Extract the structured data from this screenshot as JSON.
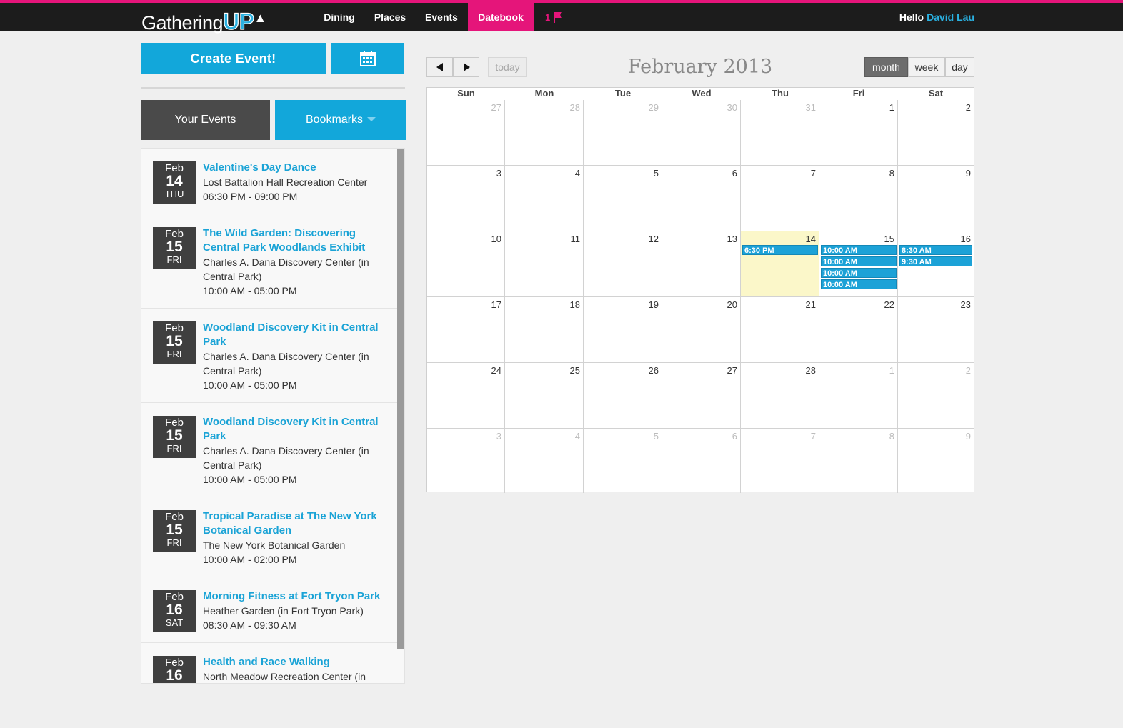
{
  "brand": {
    "name": "Gathering",
    "name_accent": "UP"
  },
  "nav": {
    "items": [
      {
        "label": "Dining"
      },
      {
        "label": "Places"
      },
      {
        "label": "Events"
      },
      {
        "label": "Datebook",
        "active": true
      }
    ],
    "flag_count": "1",
    "hello_label": "Hello",
    "user_name": "David Lau"
  },
  "sidebar": {
    "create_label": "Create Event!",
    "calendar_icon": "calendar-icon",
    "tab_your_events": "Your Events",
    "tab_bookmarks": "Bookmarks",
    "events": [
      {
        "month": "Feb",
        "day": "14",
        "weekday": "THU",
        "title": "Valentine's Day Dance",
        "place": "Lost Battalion Hall Recreation Center",
        "time": "06:30 PM - 09:00 PM"
      },
      {
        "month": "Feb",
        "day": "15",
        "weekday": "FRI",
        "title": "The Wild Garden: Discovering Central Park Woodlands Exhibit",
        "place": "Charles A. Dana Discovery Center (in Central Park)",
        "time": "10:00 AM - 05:00 PM"
      },
      {
        "month": "Feb",
        "day": "15",
        "weekday": "FRI",
        "title": "Woodland Discovery Kit in Central Park",
        "place": "Charles A. Dana Discovery Center (in Central Park)",
        "time": "10:00 AM - 05:00 PM"
      },
      {
        "month": "Feb",
        "day": "15",
        "weekday": "FRI",
        "title": "Woodland Discovery Kit in Central Park",
        "place": "Charles A. Dana Discovery Center (in Central Park)",
        "time": "10:00 AM - 05:00 PM"
      },
      {
        "month": "Feb",
        "day": "15",
        "weekday": "FRI",
        "title": "Tropical Paradise at The New York Botanical Garden",
        "place": "The New York Botanical Garden",
        "time": "10:00 AM - 02:00 PM"
      },
      {
        "month": "Feb",
        "day": "16",
        "weekday": "SAT",
        "title": "Morning Fitness at Fort Tryon Park",
        "place": "Heather Garden (in Fort Tryon Park)",
        "time": "08:30 AM - 09:30 AM"
      },
      {
        "month": "Feb",
        "day": "16",
        "weekday": "",
        "title": "Health and Race Walking",
        "place": "North Meadow Recreation Center (in",
        "time": ""
      }
    ]
  },
  "calendar": {
    "title": "February 2013",
    "prev_icon": "prev-arrow-icon",
    "next_icon": "next-arrow-icon",
    "today_label": "today",
    "views": [
      {
        "label": "month",
        "active": true
      },
      {
        "label": "week",
        "active": false
      },
      {
        "label": "day",
        "active": false
      }
    ],
    "weekdays": [
      "Sun",
      "Mon",
      "Tue",
      "Wed",
      "Thu",
      "Fri",
      "Sat"
    ],
    "weeks": [
      [
        {
          "n": "27",
          "other": true
        },
        {
          "n": "28",
          "other": true
        },
        {
          "n": "29",
          "other": true
        },
        {
          "n": "30",
          "other": true
        },
        {
          "n": "31",
          "other": true
        },
        {
          "n": "1"
        },
        {
          "n": "2"
        }
      ],
      [
        {
          "n": "3"
        },
        {
          "n": "4"
        },
        {
          "n": "5"
        },
        {
          "n": "6"
        },
        {
          "n": "7"
        },
        {
          "n": "8"
        },
        {
          "n": "9"
        }
      ],
      [
        {
          "n": "10"
        },
        {
          "n": "11"
        },
        {
          "n": "12"
        },
        {
          "n": "13"
        },
        {
          "n": "14",
          "today": true,
          "events": [
            "6:30 PM"
          ]
        },
        {
          "n": "15",
          "events": [
            "10:00 AM",
            "10:00 AM",
            "10:00 AM",
            "10:00 AM"
          ]
        },
        {
          "n": "16",
          "events": [
            "8:30 AM",
            "9:30 AM"
          ]
        }
      ],
      [
        {
          "n": "17"
        },
        {
          "n": "18"
        },
        {
          "n": "19"
        },
        {
          "n": "20"
        },
        {
          "n": "21"
        },
        {
          "n": "22"
        },
        {
          "n": "23"
        }
      ],
      [
        {
          "n": "24"
        },
        {
          "n": "25"
        },
        {
          "n": "26"
        },
        {
          "n": "27"
        },
        {
          "n": "28"
        },
        {
          "n": "1",
          "other": true
        },
        {
          "n": "2",
          "other": true
        }
      ],
      [
        {
          "n": "3",
          "other": true
        },
        {
          "n": "4",
          "other": true
        },
        {
          "n": "5",
          "other": true
        },
        {
          "n": "6",
          "other": true
        },
        {
          "n": "7",
          "other": true
        },
        {
          "n": "8",
          "other": true
        },
        {
          "n": "9",
          "other": true
        }
      ]
    ]
  },
  "colors": {
    "accent_pink": "#e5157a",
    "accent_blue": "#12a7da",
    "today_bg": "#fbf7c9"
  }
}
